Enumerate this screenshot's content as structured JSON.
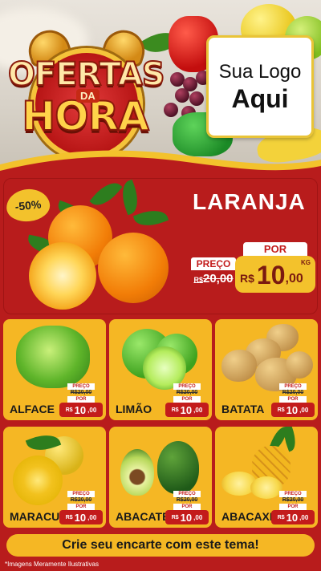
{
  "header": {
    "title_line1": "OFERTAS",
    "title_da": "DA",
    "title_line2": "HORA",
    "logo_line1": "Sua Logo",
    "logo_line2": "Aqui"
  },
  "featured": {
    "discount": "-50%",
    "name": "LARANJA",
    "por_label": "POR",
    "preco_label": "PREÇO",
    "old_currency": "R$",
    "old_price": "20,00",
    "new_currency": "R$",
    "new_price_int": "10",
    "new_price_dec": ",00",
    "unit": "KG"
  },
  "products": [
    {
      "name": "ALFACE",
      "preco_label": "PREÇO",
      "old_price": "R$20,00",
      "por_label": "POR",
      "currency": "R$",
      "price_int": "10",
      "price_dec": ",00"
    },
    {
      "name": "LIMÃO",
      "preco_label": "PREÇO",
      "old_price": "R$20,00",
      "por_label": "POR",
      "currency": "R$",
      "price_int": "10",
      "price_dec": ",00"
    },
    {
      "name": "BATATA",
      "preco_label": "PREÇO",
      "old_price": "R$20,00",
      "por_label": "POR",
      "currency": "R$",
      "price_int": "10",
      "price_dec": ",00"
    },
    {
      "name": "MARACUJÁ",
      "preco_label": "PREÇO",
      "old_price": "R$20,00",
      "por_label": "POR",
      "currency": "R$",
      "price_int": "10",
      "price_dec": ",00"
    },
    {
      "name": "ABACATE",
      "preco_label": "PREÇO",
      "old_price": "R$20,00",
      "por_label": "POR",
      "currency": "R$",
      "price_int": "10",
      "price_dec": ",00"
    },
    {
      "name": "ABACAXI",
      "preco_label": "PREÇO",
      "old_price": "R$20,00",
      "por_label": "POR",
      "currency": "R$",
      "price_int": "10",
      "price_dec": ",00"
    }
  ],
  "footer": {
    "cta": "Crie seu encarte com este tema!",
    "disclaimer": "*Imagens Meramente Ilustrativas"
  },
  "colors": {
    "background_red": "#b81c1c",
    "card_yellow": "#f5b724",
    "price_red": "#c31b1b",
    "accent_gold": "#f3c22c"
  }
}
